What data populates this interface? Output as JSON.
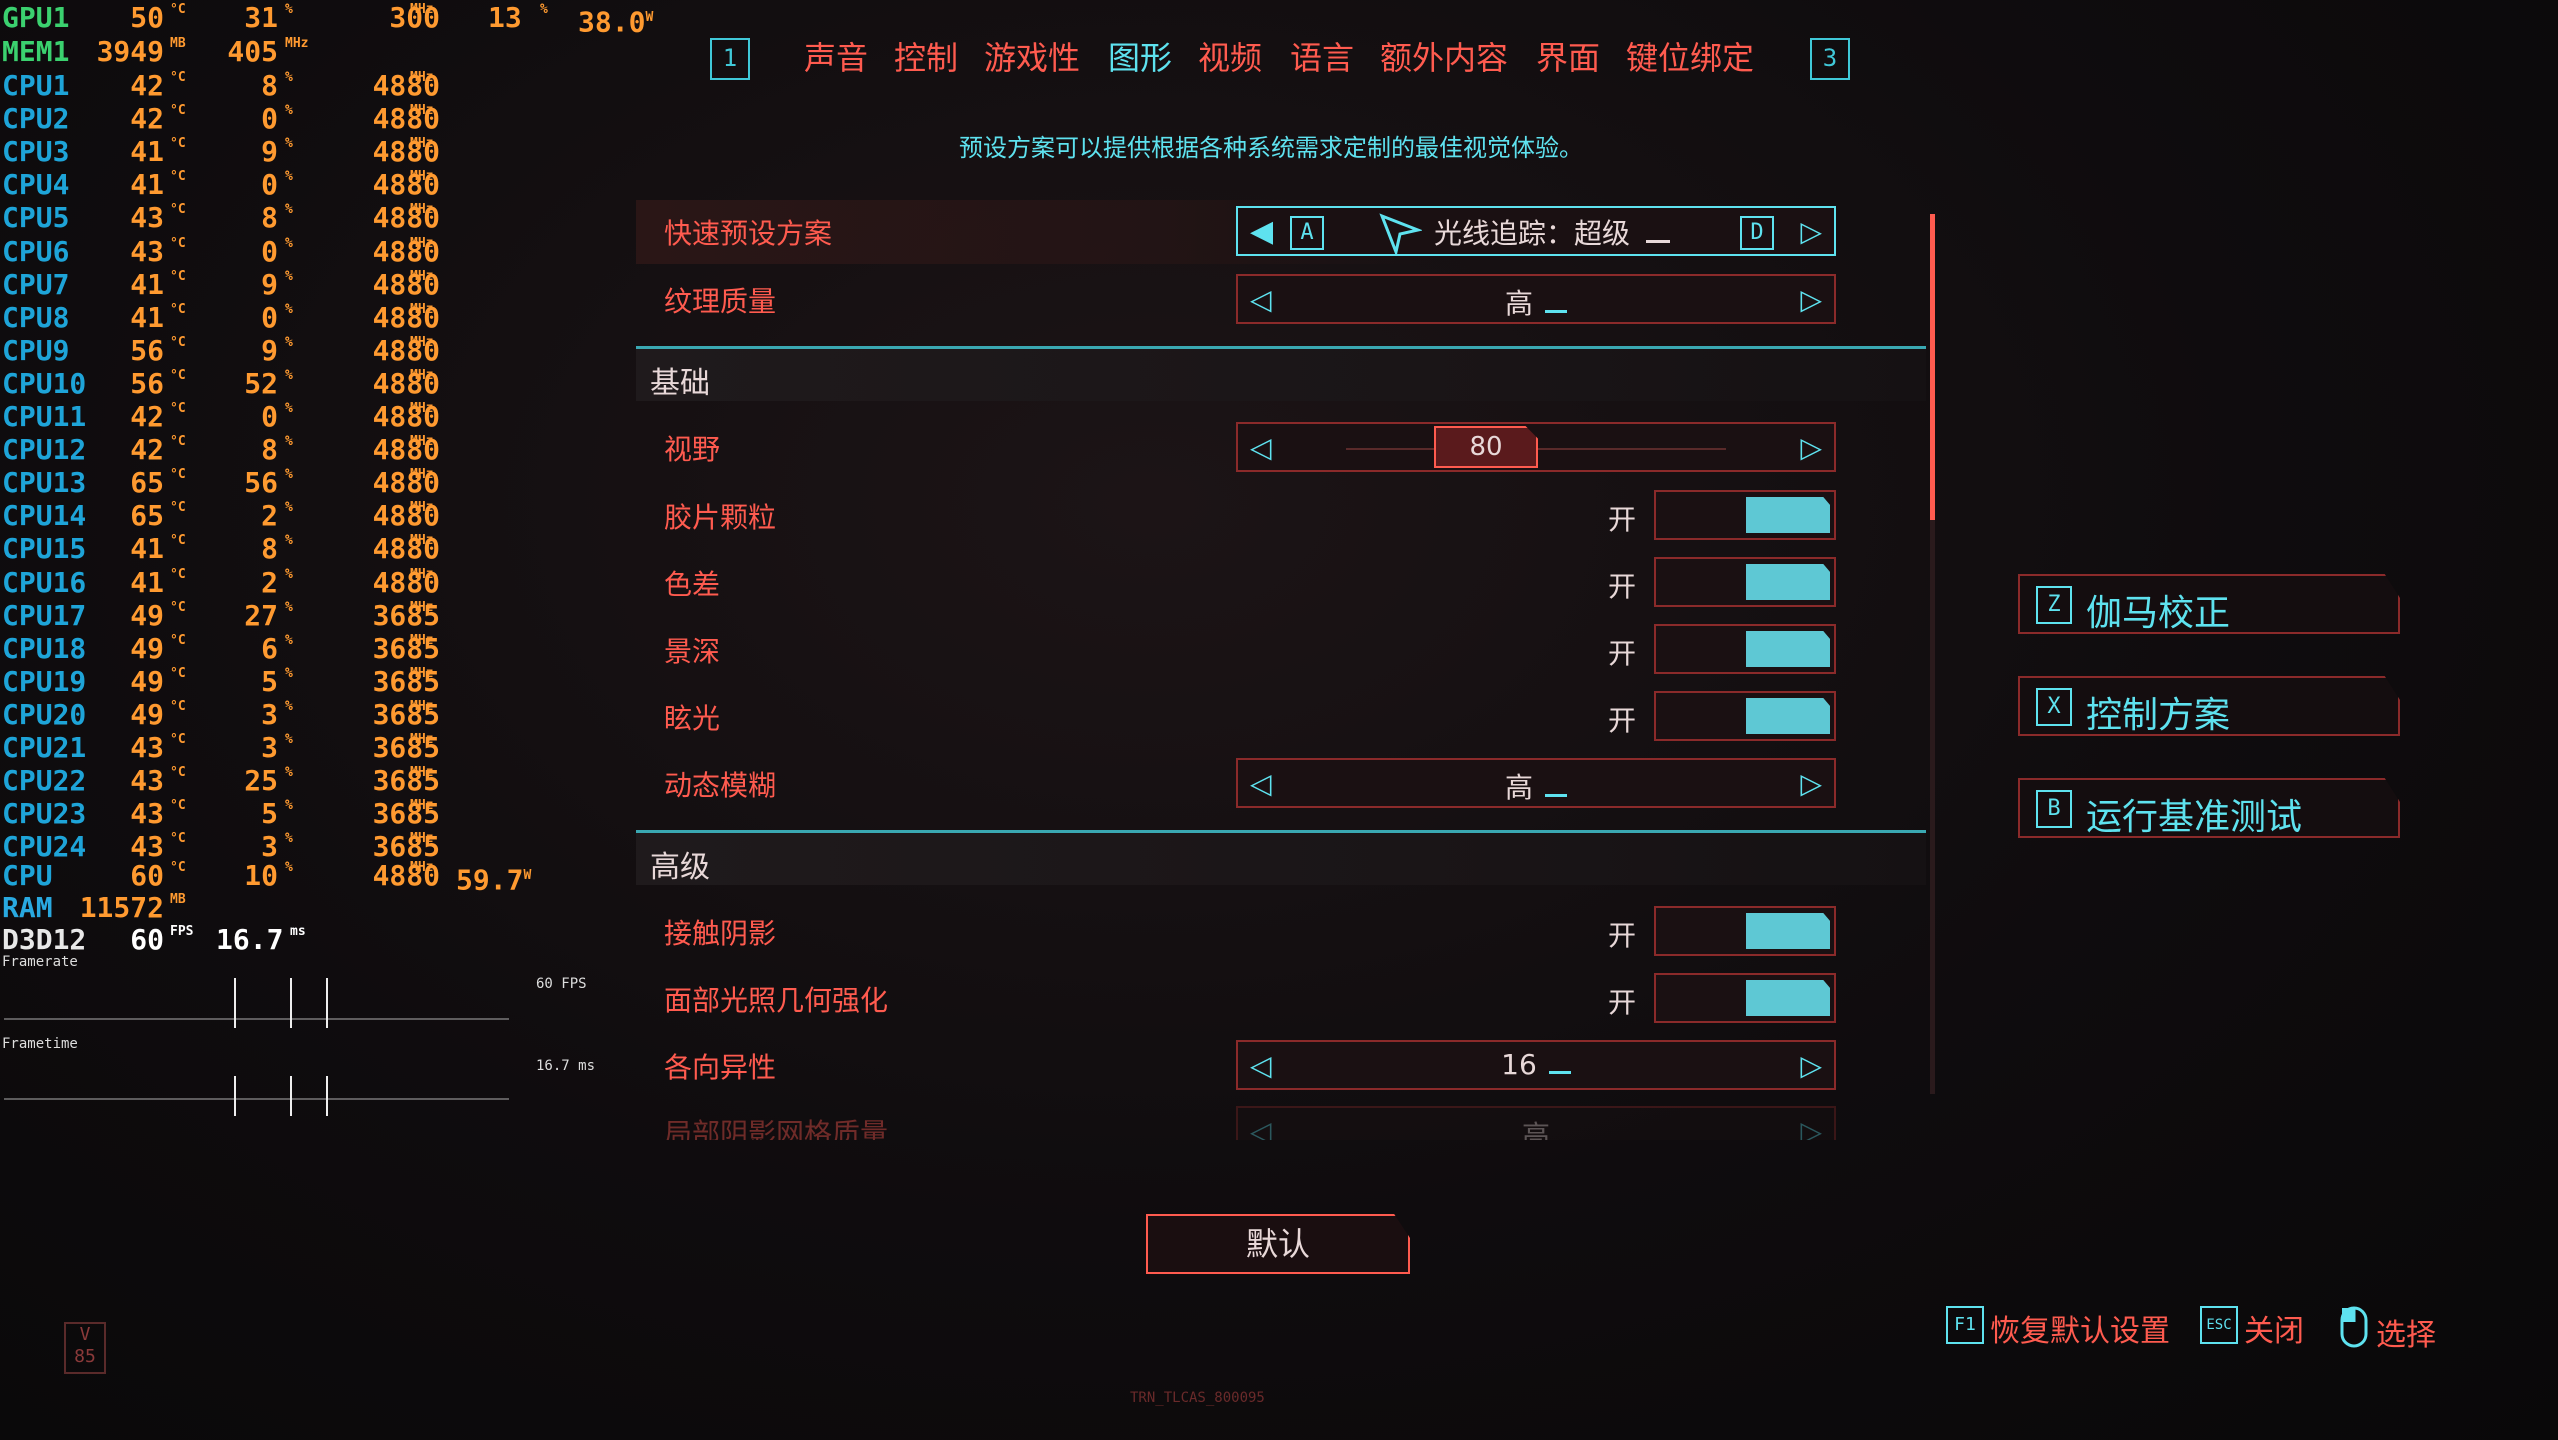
{
  "osd": {
    "gpu": {
      "label": "GPU1",
      "temp": "50",
      "temp_unit": "°C",
      "load": "31",
      "load_unit": "%",
      "clock": "300",
      "clock_unit": "MHz",
      "extra": "13",
      "extra_unit": "%",
      "power": "38.0",
      "power_unit": "W"
    },
    "mem": {
      "label": "MEM1",
      "used": "3949",
      "used_unit": "MB",
      "clock": "405",
      "clock_unit": "MHz"
    },
    "cpus": [
      {
        "label": "CPU1",
        "temp": "42",
        "load": "8",
        "clock": "4880"
      },
      {
        "label": "CPU2",
        "temp": "42",
        "load": "0",
        "clock": "4880"
      },
      {
        "label": "CPU3",
        "temp": "41",
        "load": "9",
        "clock": "4880"
      },
      {
        "label": "CPU4",
        "temp": "41",
        "load": "0",
        "clock": "4880"
      },
      {
        "label": "CPU5",
        "temp": "43",
        "load": "8",
        "clock": "4880"
      },
      {
        "label": "CPU6",
        "temp": "43",
        "load": "0",
        "clock": "4880"
      },
      {
        "label": "CPU7",
        "temp": "41",
        "load": "9",
        "clock": "4880"
      },
      {
        "label": "CPU8",
        "temp": "41",
        "load": "0",
        "clock": "4880"
      },
      {
        "label": "CPU9",
        "temp": "56",
        "load": "9",
        "clock": "4880"
      },
      {
        "label": "CPU10",
        "temp": "56",
        "load": "52",
        "clock": "4880"
      },
      {
        "label": "CPU11",
        "temp": "42",
        "load": "0",
        "clock": "4880"
      },
      {
        "label": "CPU12",
        "temp": "42",
        "load": "8",
        "clock": "4880"
      },
      {
        "label": "CPU13",
        "temp": "65",
        "load": "56",
        "clock": "4880"
      },
      {
        "label": "CPU14",
        "temp": "65",
        "load": "2",
        "clock": "4880"
      },
      {
        "label": "CPU15",
        "temp": "41",
        "load": "8",
        "clock": "4880"
      },
      {
        "label": "CPU16",
        "temp": "41",
        "load": "2",
        "clock": "4880"
      },
      {
        "label": "CPU17",
        "temp": "49",
        "load": "27",
        "clock": "3685"
      },
      {
        "label": "CPU18",
        "temp": "49",
        "load": "6",
        "clock": "3685"
      },
      {
        "label": "CPU19",
        "temp": "49",
        "load": "5",
        "clock": "3685"
      },
      {
        "label": "CPU20",
        "temp": "49",
        "load": "3",
        "clock": "3685"
      },
      {
        "label": "CPU21",
        "temp": "43",
        "load": "3",
        "clock": "3685"
      },
      {
        "label": "CPU22",
        "temp": "43",
        "load": "25",
        "clock": "3685"
      },
      {
        "label": "CPU23",
        "temp": "43",
        "load": "5",
        "clock": "3685"
      },
      {
        "label": "CPU24",
        "temp": "43",
        "load": "3",
        "clock": "3685"
      }
    ],
    "cpu_total": {
      "label": "CPU",
      "temp": "60",
      "load": "10",
      "clock": "4880",
      "power": "59.7",
      "power_unit": "W"
    },
    "ram": {
      "label": "RAM",
      "used": "11572",
      "unit": "MB"
    },
    "d3d": {
      "label": "D3D12",
      "fps": "60",
      "fps_unit": "FPS",
      "frametime": "16.7",
      "frametime_unit": "ms"
    },
    "framerate_label": "Framerate",
    "framerate_mark": "60 FPS",
    "frametime_label": "Frametime",
    "frametime_mark": "16.7 ms"
  },
  "tabs": {
    "left_key": "1",
    "right_key": "3",
    "items": [
      "声音",
      "控制",
      "游戏性",
      "图形",
      "视频",
      "语言",
      "额外内容",
      "界面",
      "键位绑定"
    ],
    "active": "图形"
  },
  "subtitle": "预设方案可以提供根据各种系统需求定制的最佳视觉体验。",
  "settings": {
    "preset": {
      "name": "快速预设方案",
      "key_left": "A",
      "key_right": "D",
      "value": "光线追踪：超级"
    },
    "texture": {
      "name": "纹理质量",
      "value": "高"
    },
    "section_basic": "基础",
    "fov": {
      "name": "视野",
      "value": "80"
    },
    "film_grain": {
      "name": "胶片颗粒",
      "state": "开"
    },
    "chromatic": {
      "name": "色差",
      "state": "开"
    },
    "dof": {
      "name": "景深",
      "state": "开"
    },
    "lens_flare": {
      "name": "眩光",
      "state": "开"
    },
    "motion_blur": {
      "name": "动态模糊",
      "value": "高"
    },
    "section_advanced": "高级",
    "contact_shadows": {
      "name": "接触阴影",
      "state": "开"
    },
    "face_lighting": {
      "name": "面部光照几何强化",
      "state": "开"
    },
    "anisotropy": {
      "name": "各向异性",
      "value": "16"
    },
    "local_shadow_mesh": {
      "name": "局部阴影网格质量",
      "value": "高"
    }
  },
  "side_buttons": [
    {
      "key": "Z",
      "label": "伽马校正"
    },
    {
      "key": "X",
      "label": "控制方案"
    },
    {
      "key": "B",
      "label": "运行基准测试"
    }
  ],
  "default_button": "默认",
  "hints": [
    {
      "key": "F1",
      "label": "恢复默认设置"
    },
    {
      "key": "ESC",
      "label": "关闭"
    },
    {
      "key": "mouse",
      "label": "选择"
    }
  ],
  "version": "V 85",
  "footer": "TRN_TLCAS_800095",
  "colors": {
    "accent_cyan": "#5ee2ef",
    "accent_red": "#ff5b4f",
    "frame_red": "#8b2a2a",
    "osd_orange": "#ff9a30",
    "osd_blue": "#1ea4d8",
    "osd_green": "#3bd16f"
  }
}
